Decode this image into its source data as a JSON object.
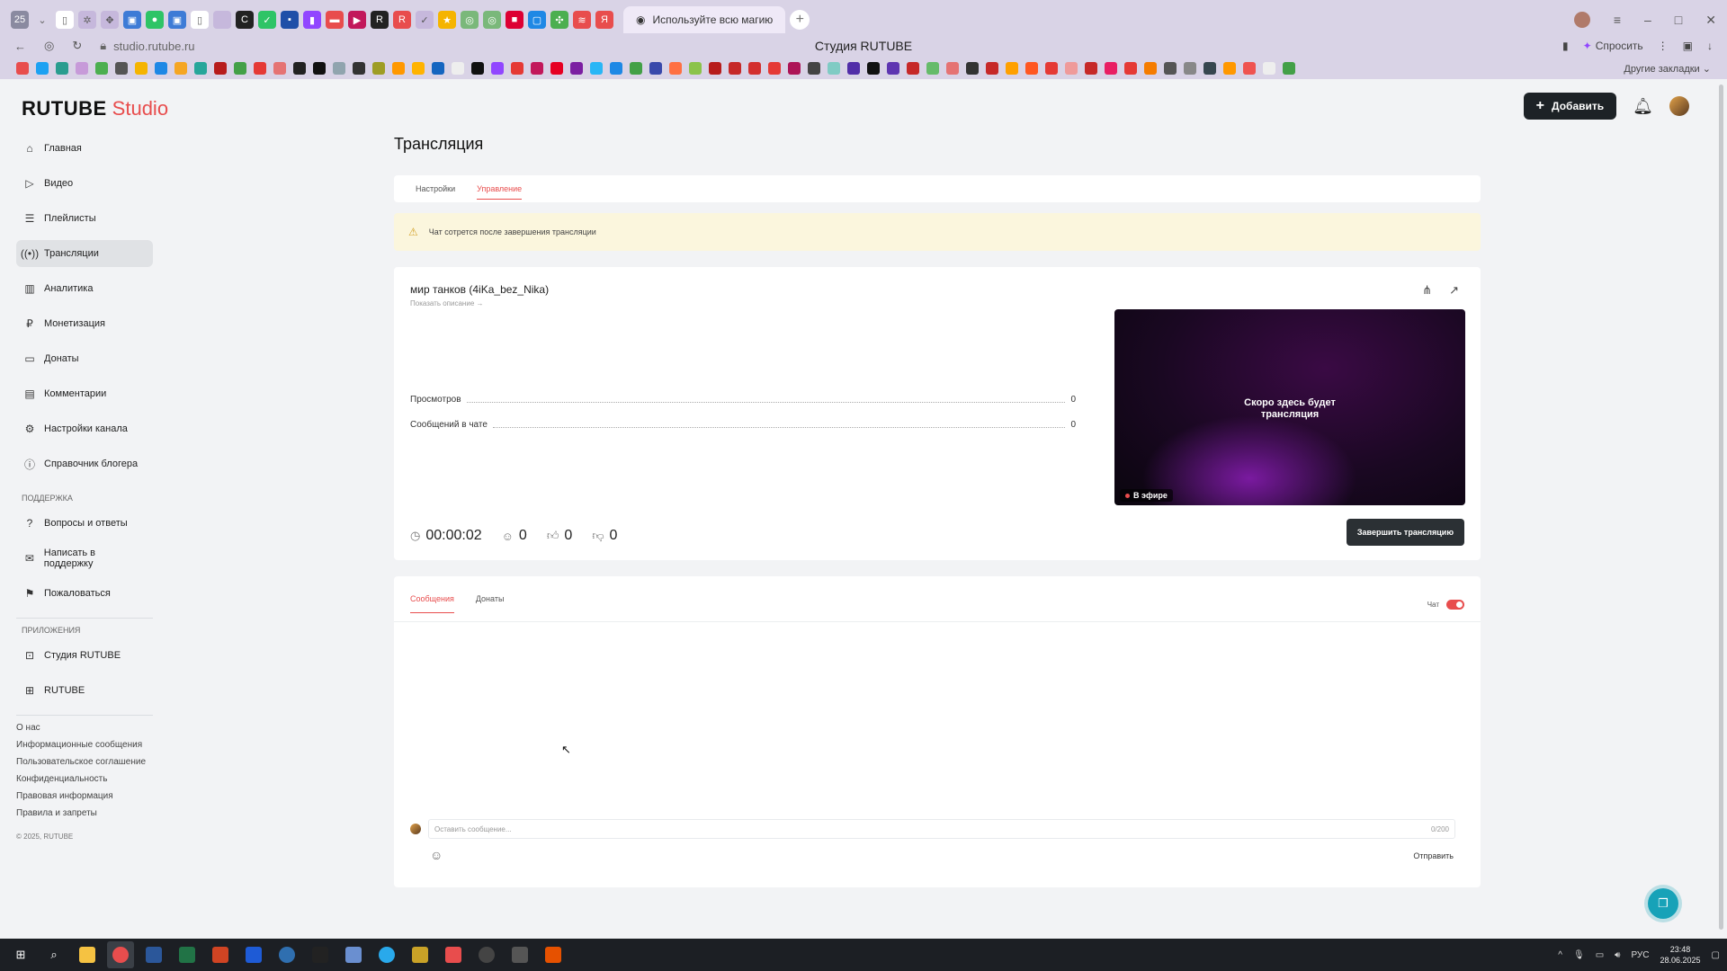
{
  "browser": {
    "tab_count": "25",
    "active_tab_title": "Используйте всю магию",
    "url": "studio.rutube.ru",
    "page_title": "Студия RUTUBE",
    "ask_label": "Спросить",
    "other_bookmarks": "Другие закладки"
  },
  "app": {
    "logo": "RUTUBE",
    "logo_suffix": "Studio",
    "add_button": "Добавить"
  },
  "sidebar": {
    "items": [
      {
        "label": "Главная",
        "icon": "home-icon"
      },
      {
        "label": "Видео",
        "icon": "video-icon"
      },
      {
        "label": "Плейлисты",
        "icon": "list-icon"
      },
      {
        "label": "Трансляции",
        "icon": "broadcast-icon"
      },
      {
        "label": "Аналитика",
        "icon": "chart-icon"
      },
      {
        "label": "Монетизация",
        "icon": "ruble-icon"
      },
      {
        "label": "Донаты",
        "icon": "donate-icon"
      },
      {
        "label": "Комментарии",
        "icon": "comment-icon"
      },
      {
        "label": "Настройки канала",
        "icon": "gear-icon"
      },
      {
        "label": "Справочник блогера",
        "icon": "info-icon"
      }
    ],
    "support_title": "ПОДДЕРЖКА",
    "support_items": [
      {
        "label": "Вопросы и ответы",
        "icon": "question-icon"
      },
      {
        "label": "Написать в поддержку",
        "icon": "mail-icon"
      },
      {
        "label": "Пожаловаться",
        "icon": "flag-icon"
      }
    ],
    "apps_title": "ПРИЛОЖЕНИЯ",
    "apps_items": [
      {
        "label": "Студия RUTUBE",
        "icon": "studio-icon"
      },
      {
        "label": "RUTUBE",
        "icon": "rutube-icon"
      }
    ],
    "footer_links": [
      "О нас",
      "Информационные сообщения",
      "Пользовательское соглашение",
      "Конфиденциальность",
      "Правовая информация",
      "Правила и запреты"
    ],
    "copyright": "© 2025, RUTUBE"
  },
  "main": {
    "title": "Трансляция",
    "tabs": [
      "Настройки",
      "Управление"
    ],
    "warning": "Чат сотрется после завершения трансляции",
    "stream": {
      "title": "мир танков (4iKa_bez_Nika)",
      "show_description": "Показать описание →",
      "stats": [
        {
          "label": "Просмотров",
          "value": "0"
        },
        {
          "label": "Сообщений в чате",
          "value": "0"
        }
      ],
      "preview_text_line1": "Скоро здесь будет",
      "preview_text_line2": "трансляция",
      "live_badge": "В эфире",
      "duration": "00:00:02",
      "viewers": "0",
      "likes": "0",
      "dislikes": "0",
      "end_button": "Завершить трансляцию"
    },
    "chat": {
      "tabs": [
        "Сообщения",
        "Донаты"
      ],
      "toggle_label": "Чат",
      "toggle_on": true,
      "input_placeholder": "Оставить сообщение...",
      "char_count": "0/200",
      "send_label": "Отправить"
    }
  },
  "taskbar": {
    "lang": "РУС",
    "time": "23:48",
    "date": "28.06.2025"
  },
  "colors": {
    "accent": "#e84d4d",
    "dark_button": "#2b3034",
    "warning_bg": "#fbf6dd"
  }
}
